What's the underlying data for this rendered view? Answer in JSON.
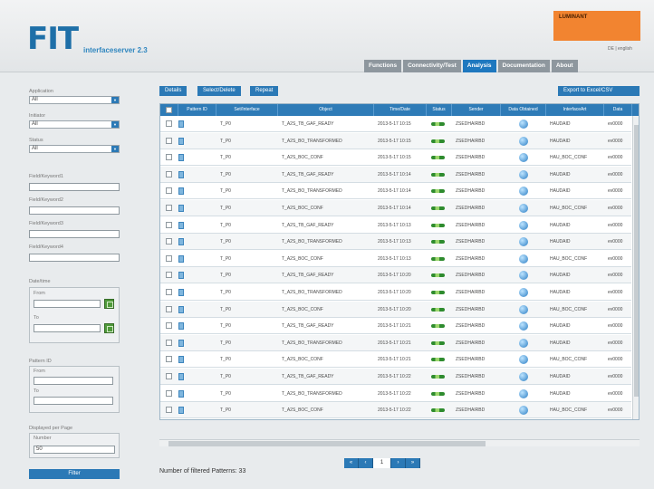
{
  "header": {
    "logo": "FIT",
    "subtitle": "interfaceserver 2.3",
    "user_name": "LUMINANT",
    "language": "DE | english",
    "tabs": [
      "Functions",
      "Connectivity/Test",
      "Analysis",
      "Documentation",
      "About"
    ],
    "active_tab": "Analysis"
  },
  "sidebar": {
    "application_label": "Application",
    "application_value": "All",
    "initiator_label": "Initiator",
    "initiator_value": "All",
    "status_label": "Status",
    "status_value": "All",
    "field_labels": [
      "Field/Keyword1",
      "Field/Keyword2",
      "Field/Keyword3",
      "Field/Keyword4"
    ],
    "date_group_label": "Date/time",
    "from_label": "From",
    "to_label": "To",
    "pattern_label": "Pattern ID",
    "pattern_from_label": "From",
    "pattern_to_label": "To",
    "rows_label": "Displayed per Page",
    "rows_value_label": "Number",
    "rows_value": "50",
    "filter_button": "Filter"
  },
  "toolbar": {
    "buttons": [
      "Details",
      "Select/Delete",
      "Repeat"
    ],
    "right_button": "Export to Excel/CSV"
  },
  "table": {
    "columns": [
      "Pattern ID",
      "Set/Interface",
      "Object",
      "Time/Date",
      "Status",
      "Sender",
      "Data Obtained",
      "InterfaceArt",
      "Data"
    ],
    "rows": [
      [
        "",
        "T_P0",
        "T_A2S_TB_GAF_READY",
        "2013-5-17 10:15",
        "",
        "ZSEDHAIRBD",
        "",
        "HAUDAID",
        "ev0000"
      ],
      [
        "",
        "T_P0",
        "T_A2S_BO_TRANSFORMED",
        "2013-5-17 10:15",
        "",
        "ZSEDHAIRBD",
        "",
        "HAUDAID",
        "ev0000"
      ],
      [
        "",
        "T_P0",
        "T_A2S_BOC_CONF",
        "2013-5-17 10:15",
        "",
        "ZSEDHAIRBD",
        "",
        "HAU_BOC_CONF",
        "ev0000"
      ],
      [
        "",
        "T_P0",
        "T_A2S_TB_GAF_READY",
        "2013-5-17 10:14",
        "",
        "ZSEDHAIRBD",
        "",
        "HAUDAID",
        "ev0000"
      ],
      [
        "",
        "T_P0",
        "T_A2S_BO_TRANSFORMED",
        "2013-5-17 10:14",
        "",
        "ZSEDHAIRBD",
        "",
        "HAUDAID",
        "ev0000"
      ],
      [
        "",
        "T_P0",
        "T_A2S_BOC_CONF",
        "2013-5-17 10:14",
        "",
        "ZSEDHAIRBD",
        "",
        "HAU_BOC_CONF",
        "ev0000"
      ],
      [
        "",
        "T_P0",
        "T_A2S_TB_GAF_READY",
        "2013-5-17 10:13",
        "",
        "ZSEDHAIRBD",
        "",
        "HAUDAID",
        "ev0000"
      ],
      [
        "",
        "T_P0",
        "T_A2S_BO_TRANSFORMED",
        "2013-5-17 10:13",
        "",
        "ZSEDHAIRBD",
        "",
        "HAUDAID",
        "ev0000"
      ],
      [
        "",
        "T_P0",
        "T_A2S_BOC_CONF",
        "2013-5-17 10:13",
        "",
        "ZSEDHAIRBD",
        "",
        "HAU_BOC_CONF",
        "ev0000"
      ],
      [
        "",
        "T_P0",
        "T_A2S_TB_GAF_READY",
        "2013-5-17 10:20",
        "",
        "ZSEDHAIRBD",
        "",
        "HAUDAID",
        "ev0000"
      ],
      [
        "",
        "T_P0",
        "T_A2S_BO_TRANSFORMED",
        "2013-5-17 10:20",
        "",
        "ZSEDHAIRBD",
        "",
        "HAUDAID",
        "ev0000"
      ],
      [
        "",
        "T_P0",
        "T_A2S_BOC_CONF",
        "2013-5-17 10:20",
        "",
        "ZSEDHAIRBD",
        "",
        "HAU_BOC_CONF",
        "ev0000"
      ],
      [
        "",
        "T_P0",
        "T_A2S_TB_GAF_READY",
        "2013-5-17 10:21",
        "",
        "ZSEDHAIRBD",
        "",
        "HAUDAID",
        "ev0000"
      ],
      [
        "",
        "T_P0",
        "T_A2S_BO_TRANSFORMED",
        "2013-5-17 10:21",
        "",
        "ZSEDHAIRBD",
        "",
        "HAUDAID",
        "ev0000"
      ],
      [
        "",
        "T_P0",
        "T_A2S_BOC_CONF",
        "2013-5-17 10:21",
        "",
        "ZSEDHAIRBD",
        "",
        "HAU_BOC_CONF",
        "ev0000"
      ],
      [
        "",
        "T_P0",
        "T_A2S_TB_GAF_READY",
        "2013-5-17 10:22",
        "",
        "ZSEDHAIRBD",
        "",
        "HAUDAID",
        "ev0000"
      ],
      [
        "",
        "T_P0",
        "T_A2S_BO_TRANSFORMED",
        "2013-5-17 10:22",
        "",
        "ZSEDHAIRBD",
        "",
        "HAUDAID",
        "ev0000"
      ],
      [
        "",
        "T_P0",
        "T_A2S_BOC_CONF",
        "2013-5-17 10:22",
        "",
        "ZSEDHAIRBD",
        "",
        "HAU_BOC_CONF",
        "ev0000"
      ]
    ]
  },
  "pager": [
    "«",
    "‹",
    "1",
    "›",
    "»"
  ],
  "footer": {
    "count_label": "Number of filtered Patterns:",
    "count_value": "33"
  },
  "colors": {
    "accent": "#2b79b6",
    "user_box": "#f28430",
    "status_ok": "#2e8b2e"
  }
}
